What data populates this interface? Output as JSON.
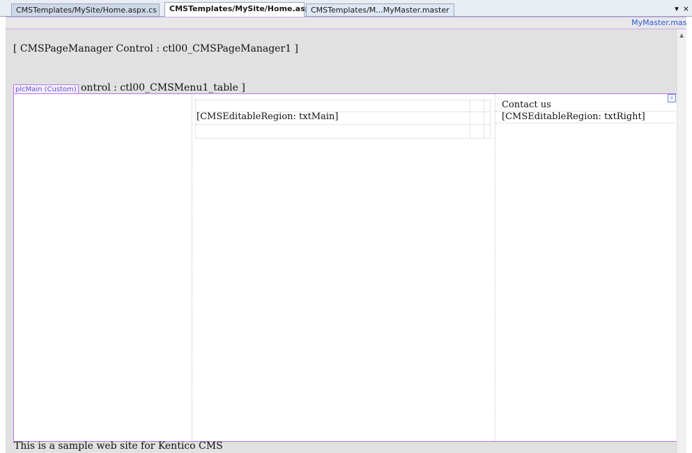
{
  "tabs": [
    {
      "label": "CMSTemplates/MySite/Home.aspx.cs",
      "active": false
    },
    {
      "label": "CMSTemplates/MySite/Home.aspx",
      "active": true
    },
    {
      "label": "CMSTemplates/M...MyMaster.master",
      "active": false
    }
  ],
  "tab_controls": {
    "dropdown": "▾",
    "close": "×"
  },
  "master": {
    "label": "MyMaster.master"
  },
  "designer": {
    "page_manager_text": "[ CMSPageManager Control : ctl00_CMSPageManager1 ]",
    "menu_text": "ontrol : ctl00_CMSMenu1_table ]",
    "placeholder_tag": "plcMain (Custom)",
    "main_region": "[CMSEditableRegion: txtMain]",
    "contact_label": "Contact us",
    "right_region": "[CMSEditableRegion: txtRight]",
    "expand_glyph": "›",
    "footer_text": "This is a sample web site for Kentico CMS"
  },
  "colors": {
    "tag_border": "#c06cf0",
    "master_label": "#2a5bd7",
    "surface": "#e1e1e1"
  }
}
